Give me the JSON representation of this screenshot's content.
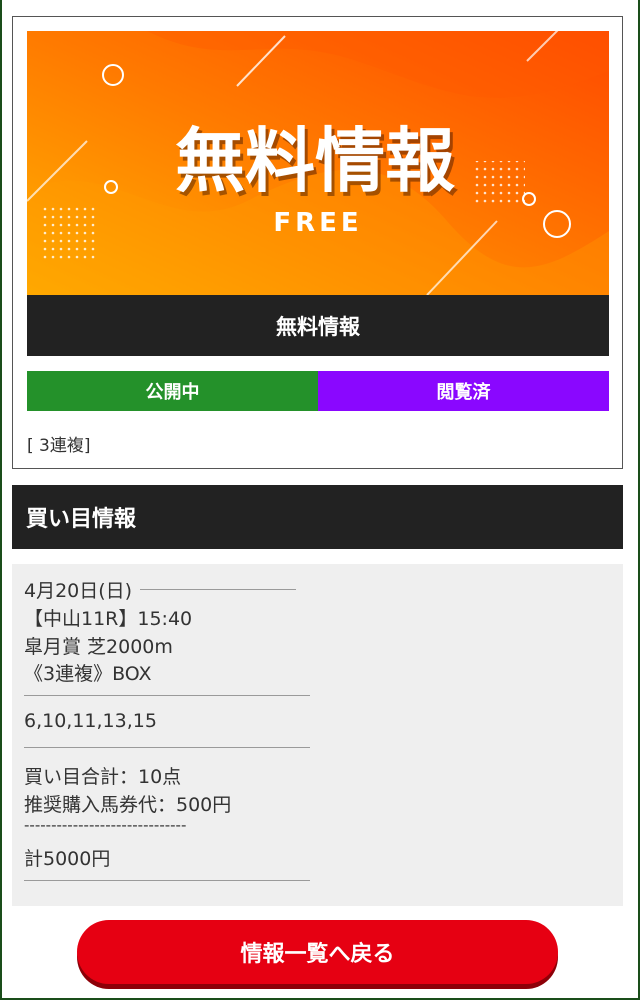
{
  "banner": {
    "headline": "無料情報",
    "subheadline": "FREE",
    "colors": {
      "start": "#ffb000",
      "mid": "#ff7a00",
      "end": "#ff4a00"
    }
  },
  "card": {
    "title": "無料情報",
    "status_public": "公開中",
    "status_viewed": "閲覧済",
    "bet_type": "[ 3連複]"
  },
  "section": {
    "title": "買い目情報"
  },
  "info": {
    "date": "4月20日(日)",
    "race": "【中山11R】15:40",
    "race_name": "皐月賞 芝2000m",
    "bet": "《3連複》BOX",
    "numbers": "6,10,11,13,15",
    "total_points": "買い目合計：10点",
    "recommended": "推奨購入馬券代：500円",
    "separator": "------------------------------",
    "total_cost": "計5000円"
  },
  "back_button": {
    "label": "情報一覧へ戻る"
  },
  "colors": {
    "public_green": "#24912a",
    "viewed_purple": "#8a07ff",
    "button_red": "#e60012",
    "dark_bar": "#222222"
  }
}
